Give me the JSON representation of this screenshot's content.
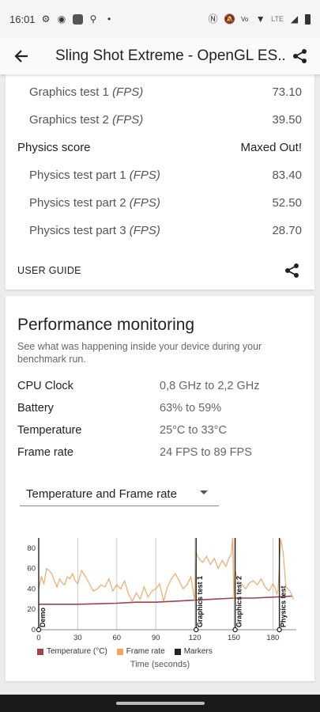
{
  "status_bar": {
    "time": "16:01",
    "lte_label": "LTE"
  },
  "app_bar": {
    "title": "Sling Shot Extreme - OpenGL ES..."
  },
  "scores": [
    {
      "label": "Graphics test 1",
      "unit": "(FPS)",
      "value": "73.10",
      "level": "sub"
    },
    {
      "label": "Graphics test 2",
      "unit": "(FPS)",
      "value": "39.50",
      "level": "sub"
    },
    {
      "label": "Physics score",
      "unit": "",
      "value": "Maxed Out!",
      "level": "main"
    },
    {
      "label": "Physics test part 1",
      "unit": "(FPS)",
      "value": "83.40",
      "level": "sub"
    },
    {
      "label": "Physics test part 2",
      "unit": "(FPS)",
      "value": "52.50",
      "level": "sub"
    },
    {
      "label": "Physics test part 3",
      "unit": "(FPS)",
      "value": "28.70",
      "level": "sub"
    }
  ],
  "user_guide": {
    "label": "USER GUIDE"
  },
  "performance": {
    "title": "Performance monitoring",
    "description": "See what was happening inside your device during your benchmark run.",
    "stats": [
      {
        "label": "CPU Clock",
        "value": "0,8 GHz to 2,2 GHz"
      },
      {
        "label": "Battery",
        "value": "63% to 59%"
      },
      {
        "label": "Temperature",
        "value": "25°C to 33°C"
      },
      {
        "label": "Frame rate",
        "value": "24 FPS to 89 FPS"
      }
    ],
    "dropdown": {
      "selected": "Temperature and Frame rate"
    }
  },
  "chart_data": {
    "type": "line",
    "xlabel": "Time (seconds)",
    "xlim": [
      0,
      198
    ],
    "ylim": [
      0,
      90
    ],
    "x_ticks": [
      0,
      30,
      60,
      90,
      120,
      150,
      180
    ],
    "y_ticks": [
      0,
      20,
      40,
      60,
      80
    ],
    "legend": [
      "Temperature (°C)",
      "Frame rate",
      "Markers"
    ],
    "colors": {
      "temperature": "#a0414f",
      "frame_rate": "#f5a25d",
      "markers": "#222222",
      "grid": "#cccccc"
    },
    "markers": [
      {
        "x": 0,
        "label": "Demo"
      },
      {
        "x": 121,
        "label": "Graphics test 1"
      },
      {
        "x": 151,
        "label": "Graphics test 2"
      },
      {
        "x": 185,
        "label": "Physics test"
      }
    ],
    "series": [
      {
        "name": "Temperature (°C)",
        "x": [
          0,
          30,
          60,
          75,
          90,
          105,
          120,
          135,
          150,
          165,
          180,
          195
        ],
        "values": [
          25,
          25,
          26,
          27,
          27,
          28,
          29,
          30,
          31,
          31,
          32,
          33
        ]
      },
      {
        "name": "Frame rate",
        "x": [
          0,
          2,
          4,
          6,
          8,
          10,
          12,
          14,
          16,
          18,
          20,
          22,
          24,
          26,
          28,
          30,
          33,
          36,
          39,
          42,
          45,
          48,
          51,
          54,
          57,
          60,
          63,
          66,
          69,
          72,
          75,
          78,
          81,
          84,
          87,
          90,
          93,
          96,
          99,
          102,
          105,
          108,
          111,
          114,
          117,
          120,
          121,
          123,
          126,
          129,
          132,
          135,
          138,
          141,
          144,
          146,
          148,
          149,
          150,
          151,
          153,
          156,
          159,
          162,
          165,
          168,
          171,
          174,
          177,
          180,
          182,
          183,
          184,
          185,
          186,
          188,
          190,
          193,
          196
        ],
        "values": [
          40,
          52,
          45,
          60,
          58,
          55,
          48,
          42,
          50,
          46,
          44,
          52,
          50,
          55,
          48,
          45,
          58,
          52,
          45,
          38,
          40,
          44,
          42,
          50,
          38,
          44,
          40,
          48,
          35,
          28,
          36,
          30,
          42,
          32,
          38,
          40,
          45,
          28,
          42,
          50,
          55,
          48,
          40,
          44,
          52,
          28,
          76,
          70,
          66,
          72,
          64,
          70,
          60,
          68,
          62,
          70,
          74,
          90,
          30,
          58,
          48,
          45,
          40,
          46,
          48,
          44,
          50,
          42,
          38,
          45,
          40,
          35,
          38,
          65,
          89,
          75,
          42,
          38,
          30
        ]
      }
    ]
  }
}
